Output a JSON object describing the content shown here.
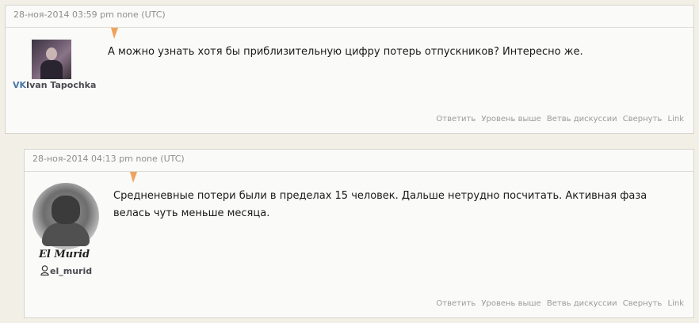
{
  "comments": [
    {
      "date": "28-ноя-2014 03:59 pm none (UTC)",
      "author": "Ivan Tapochka",
      "author_badge": "vk-icon",
      "text": "А можно узнать хотя бы приблизительную цифру потерь отпускников? Интересно же.",
      "actions": [
        "Ответить",
        "Уровень выше",
        "Ветвь дискуссии",
        "Свернуть",
        "Link"
      ]
    },
    {
      "date": "28-ноя-2014 04:13 pm none (UTC)",
      "author": "el_murid",
      "author_badge": "user-icon",
      "signature": "El Murid",
      "text": "Средненевные потери были в пределах 15 человек. Дальше нетрудно посчитать. Активная фаза велась чуть меньше месяца.",
      "actions": [
        "Ответить",
        "Уровень выше",
        "Ветвь дискуссии",
        "Свернуть",
        "Link"
      ]
    }
  ],
  "colors": {
    "background": "#f1efe6",
    "card": "#fafaf8",
    "marker": "#f0a35e",
    "vk": "#4a76a8"
  }
}
